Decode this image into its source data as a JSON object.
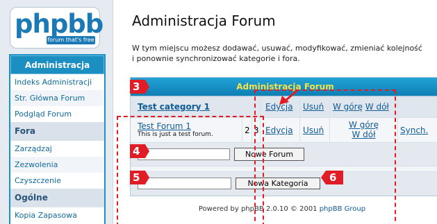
{
  "logo": {
    "brand": "phpbb",
    "tagline": "forum that's free"
  },
  "sidebar": {
    "admin_header": "Administracja",
    "admin_links": [
      "Indeks Administracji",
      "Str. Główna Forum",
      "Podgląd Forum"
    ],
    "fora_header": "Fora",
    "fora_links": [
      "Zarządzaj",
      "Zezwolenia",
      "Czyszczenie"
    ],
    "general_header": "Ogólne",
    "general_links": [
      "Kopia Zapasowa"
    ]
  },
  "main": {
    "title": "Administracja Forum",
    "intro_line1": "W tym miejscu możesz dodawać, usuwać, modyfikować, zmieniać kolejność",
    "intro_line2": "i ponownie synchronizować kategorie i fora."
  },
  "table": {
    "header": "Administracja Forum",
    "category": {
      "name": "Test category 1",
      "edit": "Edycja",
      "delete": "Usuń",
      "up": "W górę",
      "down": "W dół"
    },
    "forum": {
      "name": "Test Forum 1",
      "description": "This is just a test forum.",
      "topics": "2",
      "posts": "3",
      "edit": "Edycja",
      "delete": "Usuń",
      "up": "W górę",
      "down": "W dół",
      "sync": "Synch."
    },
    "new_forum_button": "Nowe Forum",
    "new_category_button": "Nowa Kategoria"
  },
  "footer": {
    "prefix": "Powered by phpBB 2.0.10 © 2001 ",
    "group": "phpBB Group"
  },
  "annotations": {
    "badges": [
      "3",
      "4",
      "5",
      "6"
    ],
    "color": "#e01d27"
  }
}
